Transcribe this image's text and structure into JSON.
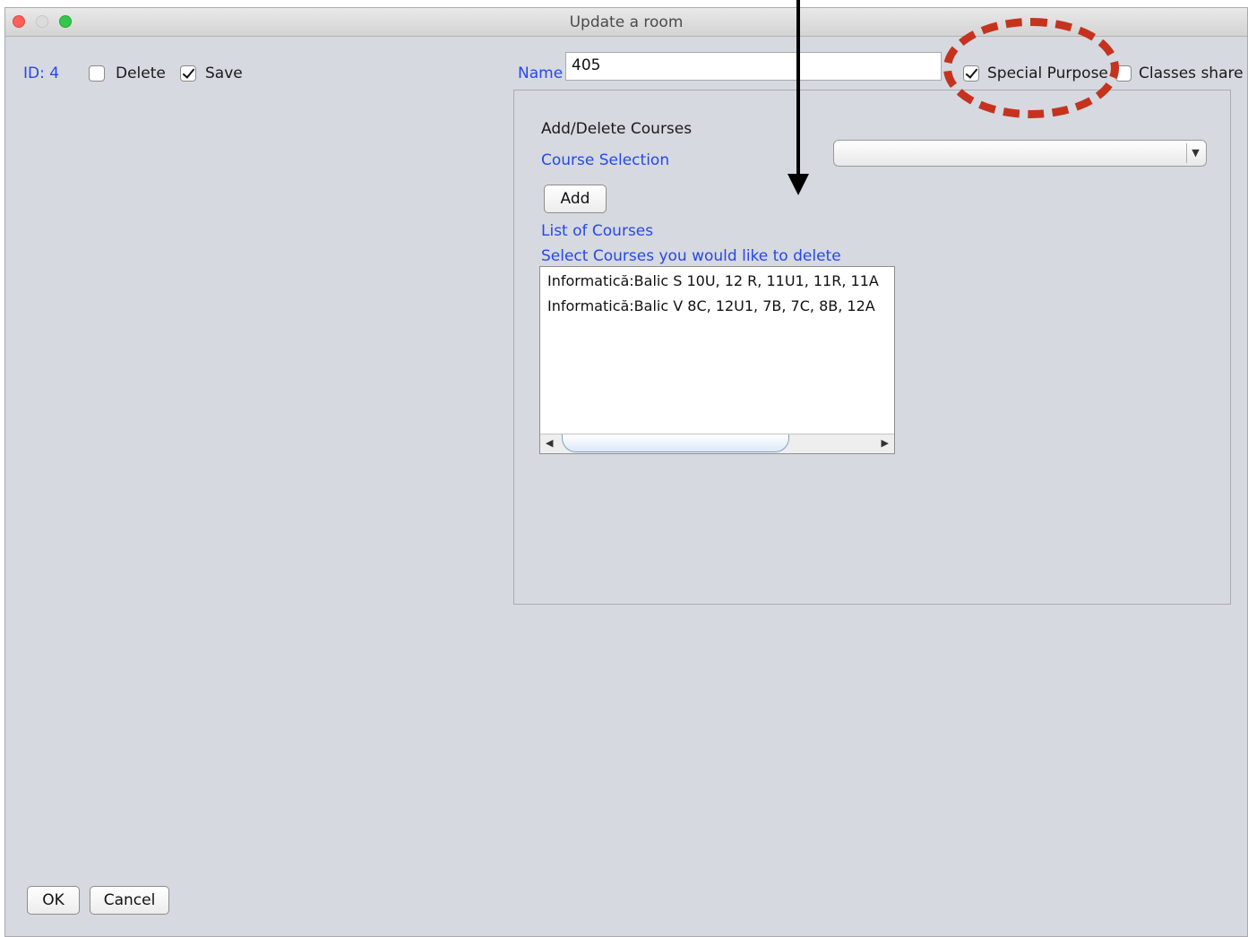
{
  "window": {
    "title": "Update a room"
  },
  "top": {
    "id_label": "ID: 4",
    "delete_label": "Delete",
    "delete_checked": false,
    "save_label": "Save",
    "save_checked": true,
    "name_label": "Name",
    "name_value": "405",
    "special_purpose_label": "Special Purpose",
    "special_purpose_checked": true,
    "classes_share_label": "Classes share",
    "classes_share_checked": false
  },
  "panel": {
    "heading": "Add/Delete Courses",
    "course_selection_label": "Course Selection",
    "course_selection_value": "",
    "add_button": "Add",
    "list_label": "List of Courses",
    "delete_hint": "Select Courses you would like to delete",
    "courses": [
      "Informatică:Balic S 10U, 12 R, 11U1, 11R, 11A",
      "Informatică:Balic V 8C, 12U1, 7B, 7C, 8B, 12A"
    ]
  },
  "footer": {
    "ok_button": "OK",
    "cancel_button": "Cancel"
  },
  "colors": {
    "label_blue": "#2648e8",
    "annotation_red": "#c5331f",
    "window_bg": "#d6d9e0"
  }
}
